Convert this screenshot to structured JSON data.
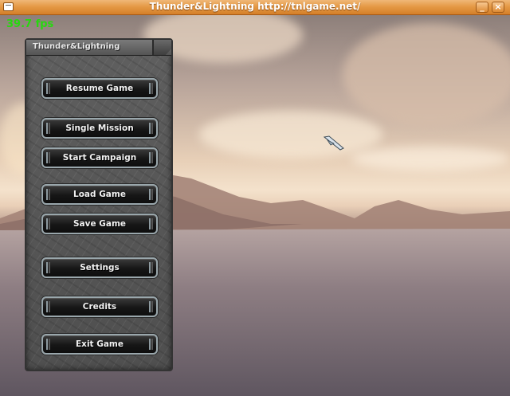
{
  "window": {
    "title": "Thunder&Lightning http://tnlgame.net/",
    "minimize_glyph": "_",
    "close_glyph": "×",
    "menu_icon": "window-menu-icon"
  },
  "hud": {
    "fps": "39.7 fps",
    "fps_color": "#27d80f"
  },
  "menu": {
    "title": "Thunder&Lightning",
    "items": [
      {
        "label": "Resume Game"
      },
      {
        "label": "Single Mission"
      },
      {
        "label": "Start Campaign"
      },
      {
        "label": "Load Game"
      },
      {
        "label": "Save Game"
      },
      {
        "label": "Settings"
      },
      {
        "label": "Credits"
      },
      {
        "label": "Exit Game"
      }
    ]
  },
  "scene": {
    "description_icon": "aircraft-icon"
  }
}
